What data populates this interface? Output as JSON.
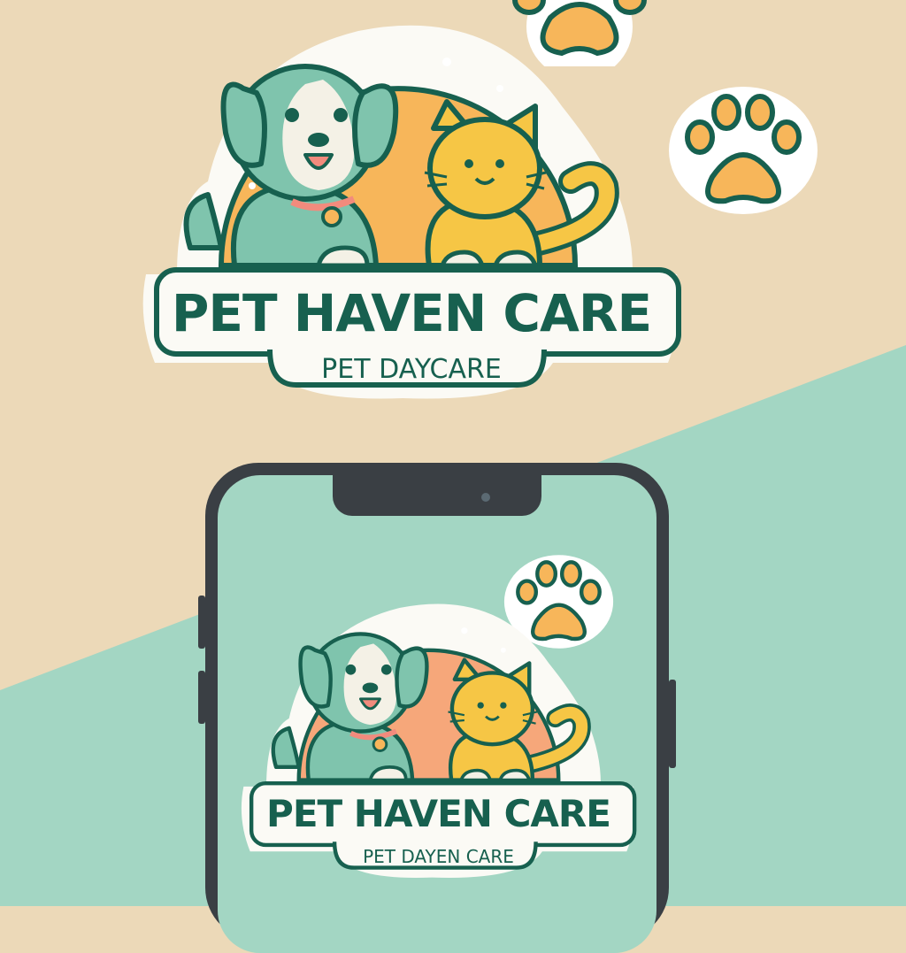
{
  "brand": {
    "name": "PET HAVEN CARE",
    "tagline": "PET DAYCARE"
  },
  "phone_logo": {
    "name": "PET HAVEN CARE",
    "tagline": "PET DAYEN CARE"
  },
  "colors": {
    "background_beige": "#ecd9b8",
    "background_mint": "#a3d6c3",
    "text_teal": "#17604f",
    "dog_green": "#7fc4ad",
    "cat_yellow": "#f6c645",
    "sun_orange": "#f7b65a",
    "phone_frame": "#3a3f44"
  },
  "icons": [
    "dog-icon",
    "cat-icon",
    "paw-print-icon",
    "sun-icon",
    "phone-camera-icon"
  ]
}
